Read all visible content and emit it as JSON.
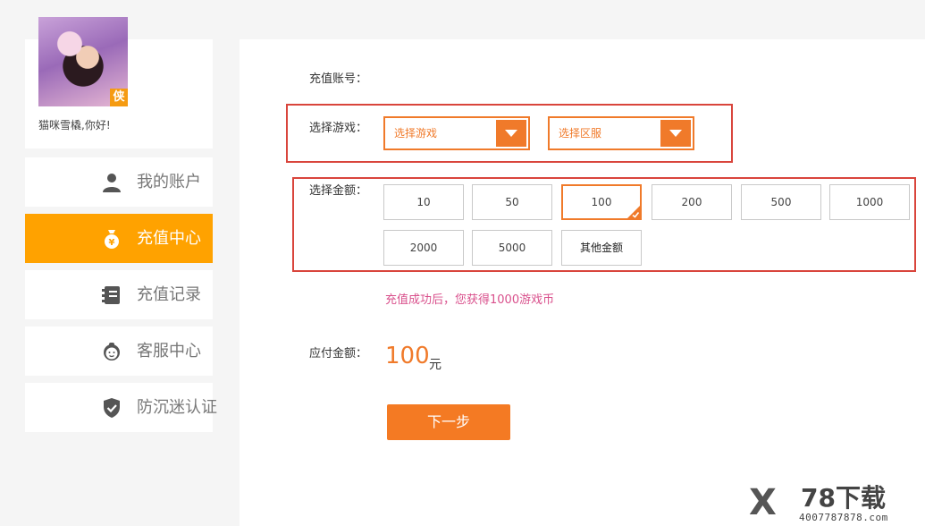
{
  "profile": {
    "badge": "侠",
    "username": "猫咪雪橇,你好!"
  },
  "menu": [
    {
      "label": "我的账户",
      "icon": "user-icon",
      "active": false
    },
    {
      "label": "充值中心",
      "icon": "money-bag-icon",
      "active": true
    },
    {
      "label": "充值记录",
      "icon": "record-list-icon",
      "active": false
    },
    {
      "label": "客服中心",
      "icon": "customer-service-icon",
      "active": false
    },
    {
      "label": "防沉迷认证",
      "icon": "shield-check-icon",
      "active": false
    }
  ],
  "form": {
    "account_label": "充值账号：",
    "game_label": "选择游戏：",
    "game_select": "选择游戏",
    "server_select": "选择区服",
    "amount_label": "选择金额：",
    "amounts": [
      "10",
      "50",
      "100",
      "200",
      "500",
      "1000",
      "2000",
      "5000",
      "其他金额"
    ],
    "selected_amount": "100",
    "tip": "充值成功后，您获得1000游戏币",
    "pay_label": "应付金额：",
    "pay_value": "100",
    "pay_unit": "元",
    "next_button": "下一步"
  },
  "watermark": {
    "mark": "X",
    "title": "78下载",
    "url": "4007787878.com"
  },
  "colors": {
    "accent": "#f07a2a",
    "menu_active": "#ffa200",
    "highlight_box": "#d9453c",
    "tip": "#d9508c"
  }
}
